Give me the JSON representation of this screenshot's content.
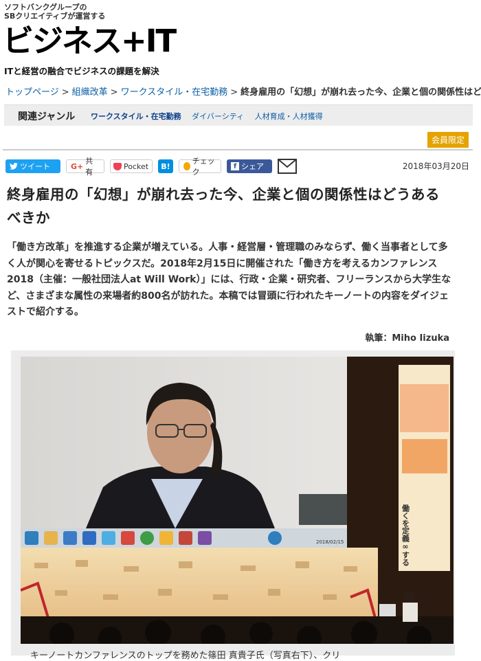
{
  "header": {
    "brand_line1": "ソフトバンクグループの",
    "brand_line2": "SBクリエイティブが運営する",
    "logo": "ビジネス+IT",
    "tagline": "ITと経営の融合でビジネスの課題を解決"
  },
  "breadcrumb": {
    "items": [
      "トップページ",
      "組織改革",
      "ワークスタイル・在宅勤務"
    ],
    "separator": ">",
    "current": "終身雇用の「幻想」が崩れ去った今、企業と個の関係性はどうあるべきか"
  },
  "genre": {
    "title": "関連ジャンル",
    "links": [
      "ワークスタイル・在宅勤務",
      "ダイバーシティ",
      "人材育成・人材獲得"
    ]
  },
  "member_badge": "会員限定",
  "share": {
    "tweet": "ツイート",
    "gplus_g": "G+",
    "gplus_label": "共有",
    "pocket": "Pocket",
    "hatena": "B!",
    "check": "チェック",
    "facebook_f": "f",
    "facebook": "シェア"
  },
  "article": {
    "date": "2018年03月20日",
    "title": "終身雇用の「幻想」が崩れ去った今、企業と個の関係性はどうあるべきか",
    "lead": "「働き方改革」を推進する企業が増えている。人事・経営層・管理職のみならず、働く当事者として多く人が関心を寄せるトピックスだ。2018年2月15日に開催された「働き方を考えるカンファレンス2018（主催：一般社団法人at Will Work）」には、行政・企業・研究者、フリーランスから大学生など、さまざまな属性の来場者約800名が訪れた。本稿では冒頭に行われたキーノートの内容をダイジェストで紹介する。",
    "author": "執筆：Miho Iizuka",
    "caption": "キーノートカンファレンスのトップを務めた篠田 真貴子氏（写真右下）、クリ"
  },
  "photo": {
    "stage_sign_text": "働くを定義∞する",
    "screen_date": "2018/02/15"
  },
  "colors": {
    "link": "#0b5fa5",
    "member": "#e5a300",
    "twitter": "#1da1f2",
    "facebook": "#3b5998",
    "hatena": "#008fde"
  }
}
